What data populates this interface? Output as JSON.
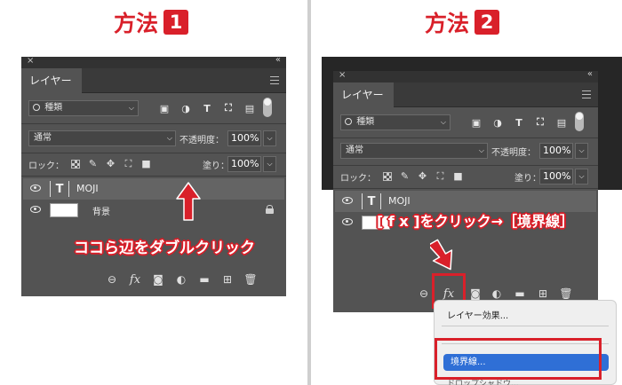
{
  "headings": {
    "method1": {
      "label": "方法",
      "num": "1"
    },
    "method2": {
      "label": "方法",
      "num": "2"
    }
  },
  "panel": {
    "close": "×",
    "collapse": "«",
    "tab_label": "レイヤー",
    "filter_label": "種類",
    "filter_chevron": "⌵",
    "filter_icons": [
      "image-icon",
      "adjustment-icon",
      "type-icon",
      "shape-icon",
      "smart-object-icon"
    ],
    "type_icon_glyph": "T",
    "blend_mode": "通常",
    "opacity_label": "不透明度：",
    "opacity_value": "100%",
    "lock_label": "ロック：",
    "fill_label": "塗り：",
    "fill_value": "100%",
    "drop": "⌵",
    "layers": [
      {
        "name": "MOJI",
        "kind": "text",
        "thumb_glyph": "T"
      },
      {
        "name": "背景",
        "kind": "background"
      }
    ],
    "bottom_icons": [
      "link-icon",
      "fx-icon",
      "mask-icon",
      "adjustment-layer-icon",
      "folder-icon",
      "new-layer-icon",
      "trash-icon"
    ],
    "fx_label": "fx"
  },
  "annotations": {
    "left": "ココら辺をダブルクリック",
    "right": "[ f x ]をクリック→［境界線］"
  },
  "popup": {
    "item1": "レイヤー効果...",
    "item_highlighted": "境界線...",
    "item_bottom": "ドロップシャドウ..."
  },
  "colors": {
    "accent_red": "#d9202a",
    "panel_bg": "#535353",
    "selection_blue": "#2f6fd6"
  }
}
